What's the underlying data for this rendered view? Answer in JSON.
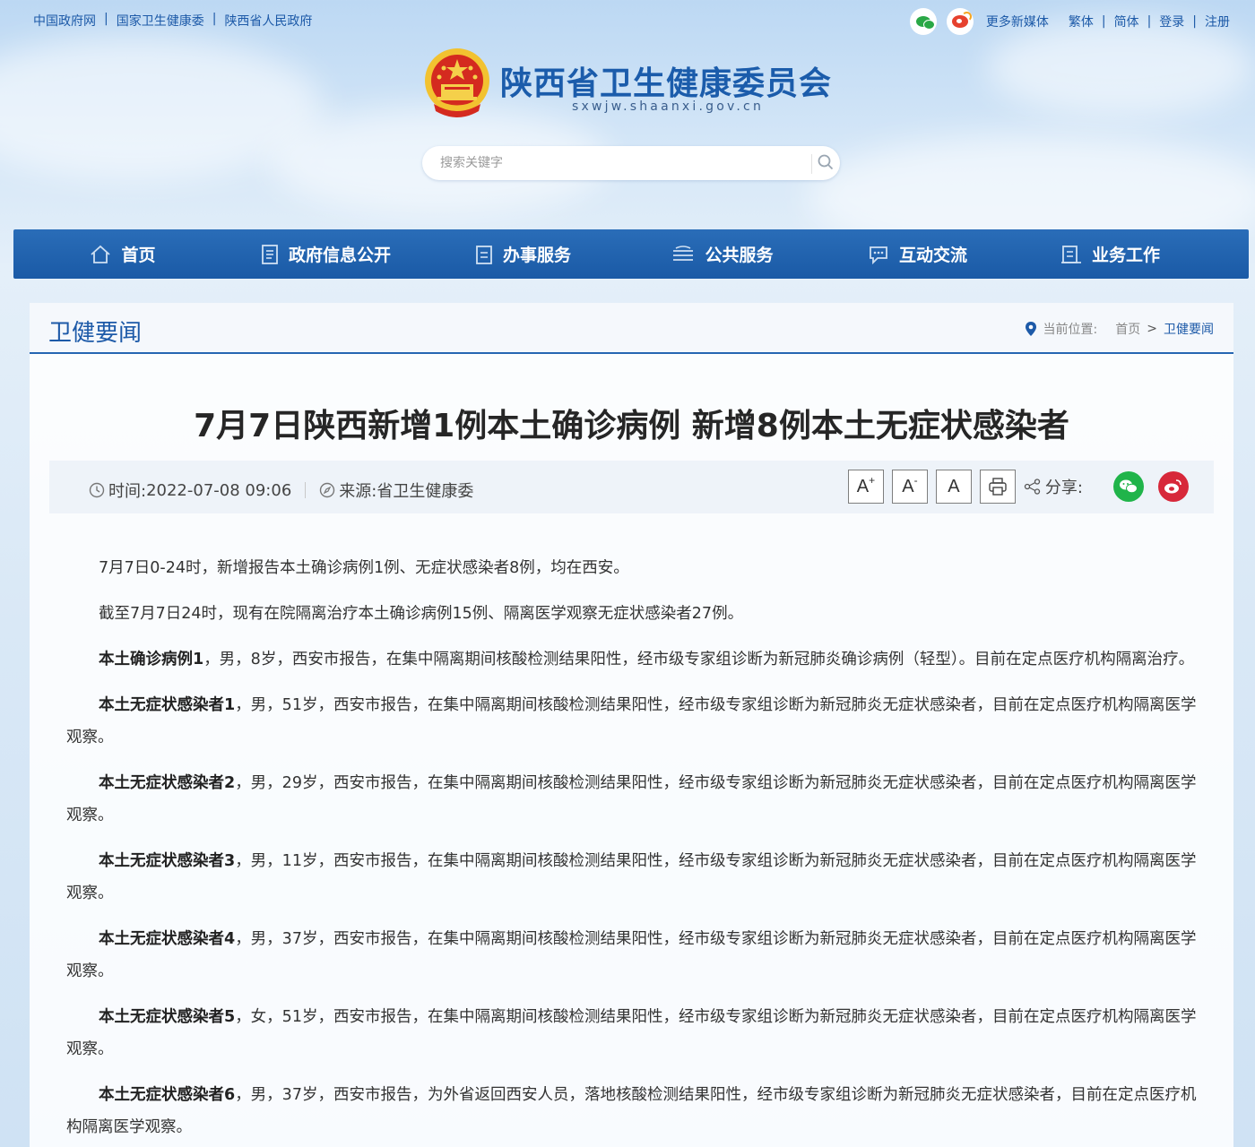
{
  "topbar": {
    "left_links": [
      "中国政府网",
      "国家卫生健康委",
      "陕西省人民政府"
    ],
    "more_media": "更多新媒体",
    "right_links": [
      "繁体",
      "简体",
      "登录",
      "注册"
    ]
  },
  "header": {
    "site_title": "陕西省卫生健康委员会",
    "site_domain": "sxwjw.shaanxi.gov.cn"
  },
  "search": {
    "placeholder": "搜索关键字"
  },
  "nav": {
    "items": [
      {
        "label": "首页",
        "icon": "home-icon"
      },
      {
        "label": "政府信息公开",
        "icon": "document-icon"
      },
      {
        "label": "办事服务",
        "icon": "clipboard-icon"
      },
      {
        "label": "公共服务",
        "icon": "service-icon"
      },
      {
        "label": "互动交流",
        "icon": "chat-icon"
      },
      {
        "label": "业务工作",
        "icon": "briefcase-icon"
      }
    ]
  },
  "section": {
    "title": "卫健要闻",
    "breadcrumb_label": "当前位置:",
    "breadcrumb_home": "首页",
    "breadcrumb_sep": ">",
    "breadcrumb_current": "卫健要闻"
  },
  "article": {
    "title": "7月7日陕西新增1例本土确诊病例 新增8例本土无症状感染者",
    "time_label": "时间:",
    "time_value": "2022-07-08 09:06",
    "source_label": "来源:",
    "source_value": "省卫生健康委",
    "font_large": "A",
    "font_large_mark": "+",
    "font_small": "A",
    "font_small_mark": "-",
    "font_normal": "A",
    "share_label": "分享:",
    "paragraphs": [
      {
        "lead": "",
        "text": "7月7日0-24时，新增报告本土确诊病例1例、无症状感染者8例，均在西安。"
      },
      {
        "lead": "",
        "text": "截至7月7日24时，现有在院隔离治疗本土确诊病例15例、隔离医学观察无症状感染者27例。"
      },
      {
        "lead": "本土确诊病例1",
        "text": "，男，8岁，西安市报告，在集中隔离期间核酸检测结果阳性，经市级专家组诊断为新冠肺炎确诊病例（轻型）。目前在定点医疗机构隔离治疗。"
      },
      {
        "lead": "本土无症状感染者1",
        "text": "，男，51岁，西安市报告，在集中隔离期间核酸检测结果阳性，经市级专家组诊断为新冠肺炎无症状感染者，目前在定点医疗机构隔离医学观察。"
      },
      {
        "lead": "本土无症状感染者2",
        "text": "，男，29岁，西安市报告，在集中隔离期间核酸检测结果阳性，经市级专家组诊断为新冠肺炎无症状感染者，目前在定点医疗机构隔离医学观察。"
      },
      {
        "lead": "本土无症状感染者3",
        "text": "，男，11岁，西安市报告，在集中隔离期间核酸检测结果阳性，经市级专家组诊断为新冠肺炎无症状感染者，目前在定点医疗机构隔离医学观察。"
      },
      {
        "lead": "本土无症状感染者4",
        "text": "，男，37岁，西安市报告，在集中隔离期间核酸检测结果阳性，经市级专家组诊断为新冠肺炎无症状感染者，目前在定点医疗机构隔离医学观察。"
      },
      {
        "lead": "本土无症状感染者5",
        "text": "，女，51岁，西安市报告，在集中隔离期间核酸检测结果阳性，经市级专家组诊断为新冠肺炎无症状感染者，目前在定点医疗机构隔离医学观察。"
      },
      {
        "lead": "本土无症状感染者6",
        "text": "，男，37岁，西安市报告，为外省返回西安人员，落地核酸检测结果阳性，经市级专家组诊断为新冠肺炎无症状感染者，目前在定点医疗机构隔离医学观察。"
      }
    ]
  },
  "colors": {
    "brand_blue": "#1d5aa8",
    "nav_blue": "#1f62ad",
    "wechat_green": "#20b44a",
    "weibo_red": "#d7283a"
  }
}
